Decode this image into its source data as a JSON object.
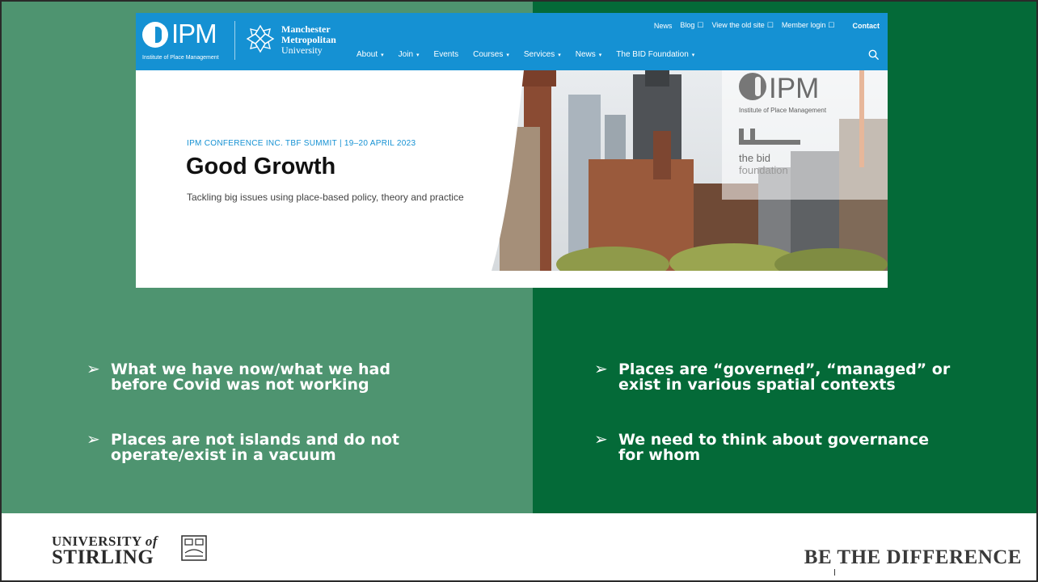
{
  "colors": {
    "left_bg": "#4e9470",
    "right_bg": "#046a38",
    "nav_blue": "#1591d3"
  },
  "website": {
    "logo": {
      "wordmark": "IPM",
      "subtitle": "Institute of Place Management"
    },
    "partner": {
      "line1": "Manchester",
      "line2": "Metropolitan",
      "line3": "University"
    },
    "top_links": [
      {
        "label": "News",
        "external": ""
      },
      {
        "label": "Blog",
        "external": "☐"
      },
      {
        "label": "View the old site",
        "external": "☐"
      },
      {
        "label": "Member login",
        "external": "☐"
      }
    ],
    "contact": "Contact",
    "menu": [
      {
        "label": "About",
        "caret": "▾"
      },
      {
        "label": "Join",
        "caret": "▾"
      },
      {
        "label": "Events",
        "caret": ""
      },
      {
        "label": "Courses",
        "caret": "▾"
      },
      {
        "label": "Services",
        "caret": "▾"
      },
      {
        "label": "News",
        "caret": "▾"
      },
      {
        "label": "The BID Foundation",
        "caret": "▾"
      }
    ],
    "hero": {
      "eyebrow": "IPM CONFERENCE INC. TBF SUMMIT | 19–20 APRIL 2023",
      "title": "Good Growth",
      "subtitle": "Tackling big issues using place-based policy, theory and practice",
      "photo_ipm": "IPM",
      "photo_ipm_sub": "Institute of Place Management",
      "photo_bid_line1": "the bid",
      "photo_bid_line2": "foundation"
    }
  },
  "bullets_left": [
    {
      "line1": "What we have now/what we had",
      "line2": "before Covid was not working"
    },
    {
      "line1": "Places are not islands and do not",
      "line2": "operate/exist in a vacuum"
    }
  ],
  "bullets_right": [
    {
      "line1": "Places are “governed”, “managed” or",
      "line2": "exist in various spatial contexts"
    },
    {
      "line1": "We need to think about governance",
      "line2": "for whom"
    }
  ],
  "bullet_arrow": "➢",
  "footer": {
    "university_line1": "UNIVERSITY",
    "university_of": "of",
    "university_line2": "STIRLING",
    "tagline": "BE THE DIFFERENCE"
  }
}
